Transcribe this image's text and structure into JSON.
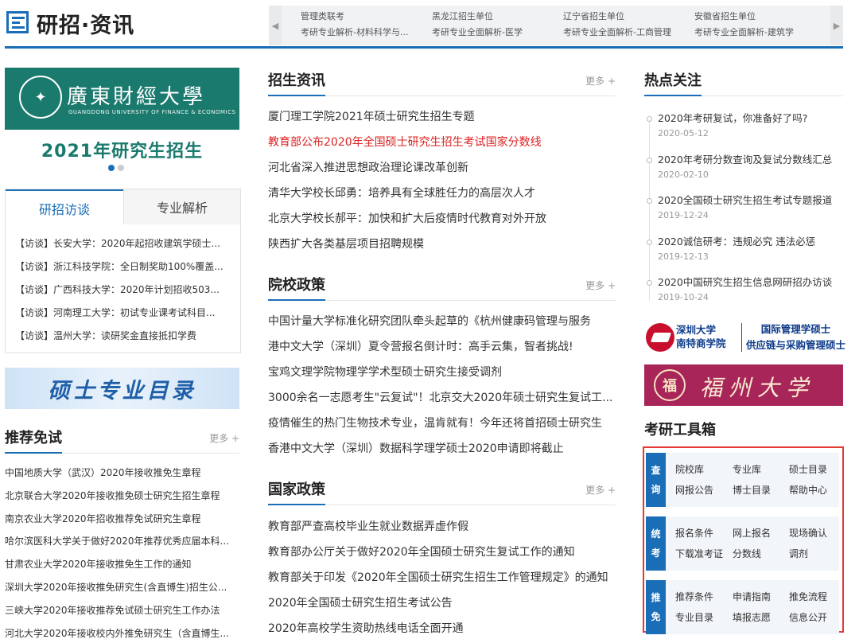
{
  "header": {
    "title": "研招·资讯",
    "ticker": [
      {
        "top": "管理类联考",
        "bottom": "考研专业解析-材料科学与..."
      },
      {
        "top": "黑龙江招生单位",
        "bottom": "考研专业全面解析-医学"
      },
      {
        "top": "辽宁省招生单位",
        "bottom": "考研专业全面解析-工商管理"
      },
      {
        "top": "安徽省招生单位",
        "bottom": "考研专业全面解析-建筑学"
      }
    ]
  },
  "banner": {
    "university_name": "廣東財經大學",
    "university_en": "GUANGDONG UNIVERSITY OF FINANCE & ECONOMICS",
    "caption": "2021年研究生招生"
  },
  "tabs": {
    "active": "研招访谈",
    "inactive": "专业解析",
    "items": [
      "【访谈】长安大学：2020年起招收建筑学硕士...",
      "【访谈】浙江科技学院：全日制奖助100%覆盖...",
      "【访谈】广西科技大学：2020年计划招收503...",
      "【访谈】河南理工大学：初试专业课考试科目...",
      "【访谈】温州大学：读研奖金直接抵扣学费"
    ]
  },
  "catalog_banner": "硕士专业目录",
  "recommend": {
    "title": "推荐免试",
    "more": "更多 +",
    "items": [
      "中国地质大学（武汉）2020年接收推免生章程",
      "北京联合大学2020年接收推免硕士研究生招生章程",
      "南京农业大学2020年招收推荐免试研究生章程",
      "哈尔滨医科大学关于做好2020年推荐优秀应届本科...",
      "甘肃农业大学2020年接收推免生工作的通知",
      "深圳大学2020年接收推免研究生(含直博生)招生公...",
      "三峡大学2020年接收推荐免试硕士研究生工作办法",
      "河北大学2020年接收校内外推免研究生（含直博生..."
    ]
  },
  "admission_news": {
    "title": "招生资讯",
    "more": "更多 +",
    "items": [
      {
        "text": "厦门理工学院2021年硕士研究生招生专题",
        "highlight": false
      },
      {
        "text": "教育部公布2020年全国硕士研究生招生考试国家分数线",
        "highlight": true
      },
      {
        "text": "河北省深入推进思想政治理论课改革创新",
        "highlight": false
      },
      {
        "text": "清华大学校长邱勇：培养具有全球胜任力的高层次人才",
        "highlight": false
      },
      {
        "text": "北京大学校长郝平：加快和扩大后疫情时代教育对外开放",
        "highlight": false
      },
      {
        "text": "陕西扩大各类基层项目招聘规模",
        "highlight": false
      }
    ]
  },
  "school_policy": {
    "title": "院校政策",
    "more": "更多 +",
    "items": [
      "中国计量大学标准化研究团队牵头起草的《杭州健康码管理与服务",
      "港中文大学（深圳）夏令营报名倒计时：高手云集，智者挑战!",
      "宝鸡文理学院物理学学术型硕士研究生接受调剂",
      "3000余名一志愿考生\"云复试\"！北京交大2020年硕士研究生复试工...",
      "疫情催生的热门生物技术专业，温肯就有！今年还将首招硕士研究生",
      "香港中文大学（深圳）数据科学理学硕士2020申请即将截止"
    ]
  },
  "national_policy": {
    "title": "国家政策",
    "more": "更多 +",
    "items": [
      "教育部严查高校毕业生就业数据弄虚作假",
      "教育部办公厅关于做好2020年全国硕士研究生复试工作的通知",
      "教育部关于印发《2020年全国硕士研究生招生工作管理规定》的通知",
      "2020年全国硕士研究生招生考试公告",
      "2020年高校学生资助热线电话全面开通"
    ]
  },
  "hot": {
    "title": "热点关注",
    "items": [
      {
        "text": "2020年考研复试，你准备好了吗?",
        "date": "2020-05-12"
      },
      {
        "text": "2020年考研分数查询及复试分数线汇总",
        "date": "2020-02-10"
      },
      {
        "text": "2020全国硕士研究生招生考试专题报道",
        "date": "2019-12-24"
      },
      {
        "text": "2020诚信研考：违规必究 违法必惩",
        "date": "2019-12-13"
      },
      {
        "text": "2020中国研究生招生信息网研招办访谈",
        "date": "2019-10-24"
      }
    ]
  },
  "ad1": {
    "line1": "深圳大学",
    "line2": "南特商学院",
    "right1": "国际管理学硕士",
    "right2": "供应链与采购管理硕士"
  },
  "ad2": {
    "emblem": "福",
    "name": "福州大学"
  },
  "tools": {
    "title": "考研工具箱",
    "accent": "#e53935",
    "blocks": [
      {
        "tag1": "查",
        "tag2": "询",
        "links": [
          "院校库",
          "专业库",
          "硕士目录",
          "网报公告",
          "博士目录",
          "帮助中心"
        ]
      },
      {
        "tag1": "统",
        "tag2": "考",
        "links": [
          "报名条件",
          "网上报名",
          "现场确认",
          "下载准考证",
          "分数线",
          "调剂"
        ]
      },
      {
        "tag1": "推",
        "tag2": "免",
        "links": [
          "推荐条件",
          "申请指南",
          "推免流程",
          "专业目录",
          "填报志愿",
          "信息公开"
        ]
      }
    ]
  }
}
